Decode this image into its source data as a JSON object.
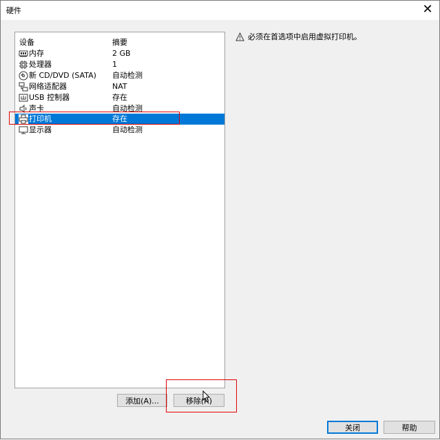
{
  "window": {
    "title": "硬件",
    "close_glyph": "✕"
  },
  "device_list": {
    "columns": {
      "device": "设备",
      "summary": "摘要"
    },
    "rows": [
      {
        "icon": "memory-icon",
        "name": "内存",
        "summary": "2 GB"
      },
      {
        "icon": "processor-icon",
        "name": "处理器",
        "summary": "1"
      },
      {
        "icon": "cd-dvd-icon",
        "name": "新 CD/DVD (SATA)",
        "summary": "自动检测"
      },
      {
        "icon": "network-adapter-icon",
        "name": "网络适配器",
        "summary": "NAT"
      },
      {
        "icon": "usb-controller-icon",
        "name": "USB 控制器",
        "summary": "存在"
      },
      {
        "icon": "sound-card-icon",
        "name": "声卡",
        "summary": "自动检测"
      },
      {
        "icon": "printer-icon",
        "name": "打印机",
        "summary": "存在",
        "selected": true
      },
      {
        "icon": "display-icon",
        "name": "显示器",
        "summary": "自动检测"
      }
    ]
  },
  "warning": {
    "icon": "warning-icon",
    "text": "必须在首选项中启用虚拟打印机。"
  },
  "buttons": {
    "add": "添加(A)...",
    "remove": "移除(R)",
    "close": "关闭",
    "help": "帮助"
  },
  "colors": {
    "selection": "#0078d7",
    "annotation_red": "#e00000",
    "background": "#f0f0f0"
  }
}
